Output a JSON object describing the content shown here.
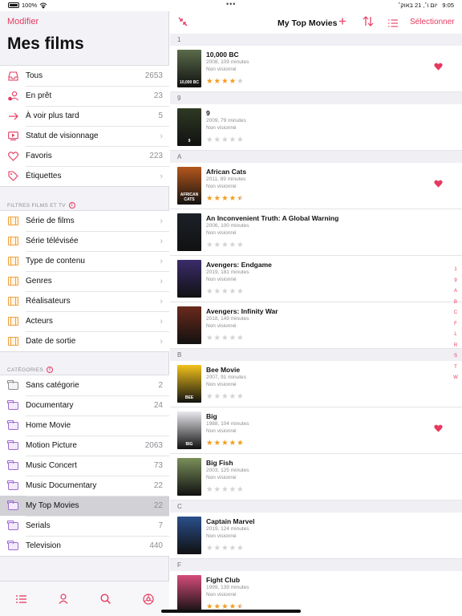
{
  "status_bar": {
    "battery": "100%",
    "time": "9:05",
    "date_rtl": "יום ו׳, 21 באוק׳"
  },
  "sidebar": {
    "edit_label": "Modifier",
    "title": "Mes films",
    "library": [
      {
        "icon": "tray-icon",
        "label": "Tous",
        "count": "2653"
      },
      {
        "icon": "person-lent-icon",
        "label": "En prêt",
        "count": "23"
      },
      {
        "icon": "arrow-right-icon",
        "label": "À voir plus tard",
        "count": "5"
      },
      {
        "icon": "play-rect-icon",
        "label": "Statut de visionnage",
        "chevron": "›"
      },
      {
        "icon": "heart-outline-icon",
        "label": "Favoris",
        "count": "223"
      },
      {
        "icon": "tag-icon",
        "label": "Étiquettes",
        "chevron": "›"
      }
    ],
    "filters_header": "FILTRES FILMS ET TV",
    "filters": [
      {
        "label": "Série de films",
        "chevron": "›"
      },
      {
        "label": "Série télévisée",
        "chevron": "›"
      },
      {
        "label": "Type de contenu",
        "chevron": "›"
      },
      {
        "label": "Genres",
        "chevron": "›"
      },
      {
        "label": "Réalisateurs",
        "chevron": "›"
      },
      {
        "label": "Acteurs",
        "chevron": "›"
      },
      {
        "label": "Date de sortie",
        "chevron": "›"
      }
    ],
    "categories_header": "CATÉGORIES",
    "categories": [
      {
        "label": "Sans catégorie",
        "count": "2"
      },
      {
        "label": "Documentary",
        "count": "24"
      },
      {
        "label": "Home Movie",
        "count": ""
      },
      {
        "label": "Motion Picture",
        "count": "2063"
      },
      {
        "label": "Music Concert",
        "count": "73"
      },
      {
        "label": "Music Documentary",
        "count": "22"
      },
      {
        "label": "My Top Movies",
        "count": "22"
      },
      {
        "label": "Serials",
        "count": "7"
      },
      {
        "label": "Television",
        "count": "440"
      }
    ],
    "info_glyph": "i",
    "tabs": [
      "list-icon",
      "person-icon",
      "search-icon",
      "settings-icon"
    ]
  },
  "main": {
    "title": "My Top Movies",
    "add_glyph": "+",
    "select_label": "Sélectionner",
    "accent": "#e5395e",
    "sections": [
      {
        "header": "1",
        "movies": [
          {
            "title": "10,000 BC",
            "meta": "2008, 109 minutes",
            "status": "Non visionné",
            "rating": 4,
            "favorite": true,
            "poster_color": "#5a6b4a",
            "poster_text": "10,000 BC"
          }
        ]
      },
      {
        "header": "9",
        "movies": [
          {
            "title": "9",
            "meta": "2009, 79 minutes",
            "status": "Non visionné",
            "rating": 0,
            "favorite": false,
            "poster_color": "#2f3a24",
            "poster_text": "9"
          }
        ]
      },
      {
        "header": "A",
        "movies": [
          {
            "title": "African Cats",
            "meta": "2011, 89 minutes",
            "status": "Non visionné",
            "rating": 4.5,
            "favorite": true,
            "poster_color": "#b5571c",
            "poster_text": "AFRICAN CATS"
          },
          {
            "title": "An Inconvenient Truth: A Global Warning",
            "meta": "2006, 100 minutes",
            "status": "Non visionné",
            "rating": 0,
            "favorite": false,
            "poster_color": "#1c2128",
            "poster_text": ""
          },
          {
            "title": "Avengers: Endgame",
            "meta": "2019, 181 minutes",
            "status": "Non visionné",
            "rating": 0,
            "favorite": false,
            "poster_color": "#3a2c6b",
            "poster_text": ""
          },
          {
            "title": "Avengers: Infinity War",
            "meta": "2018, 149 minutes",
            "status": "Non visionné",
            "rating": 0,
            "favorite": false,
            "poster_color": "#6b2a1c",
            "poster_text": ""
          }
        ]
      },
      {
        "header": "B",
        "movies": [
          {
            "title": "Bee Movie",
            "meta": "2007, 91 minutes",
            "status": "Non visionné",
            "rating": 0,
            "favorite": false,
            "poster_color": "#f2c21b",
            "poster_text": "BEE"
          },
          {
            "title": "Big",
            "meta": "1988, 104 minutes",
            "status": "Non visionné",
            "rating": 5,
            "favorite": true,
            "poster_color": "#e9e9ee",
            "poster_text": "BIG"
          },
          {
            "title": "Big Fish",
            "meta": "2003, 125 minutes",
            "status": "Non visionné",
            "rating": 0,
            "favorite": false,
            "poster_color": "#7a8f5a",
            "poster_text": ""
          }
        ]
      },
      {
        "header": "C",
        "movies": [
          {
            "title": "Captain Marvel",
            "meta": "2019, 124 minutes",
            "status": "Non visionné",
            "rating": 0,
            "favorite": false,
            "poster_color": "#2a4f8a",
            "poster_text": ""
          }
        ]
      },
      {
        "header": "F",
        "movies": [
          {
            "title": "Fight Club",
            "meta": "1999, 139 minutes",
            "status": "Non visionné",
            "rating": 4.5,
            "favorite": false,
            "poster_color": "#d54c7a",
            "poster_text": ""
          }
        ]
      }
    ],
    "index_letters": [
      "1",
      "9",
      "A",
      "B",
      "C",
      "F",
      "L",
      "R",
      "S",
      "T",
      "W"
    ]
  }
}
